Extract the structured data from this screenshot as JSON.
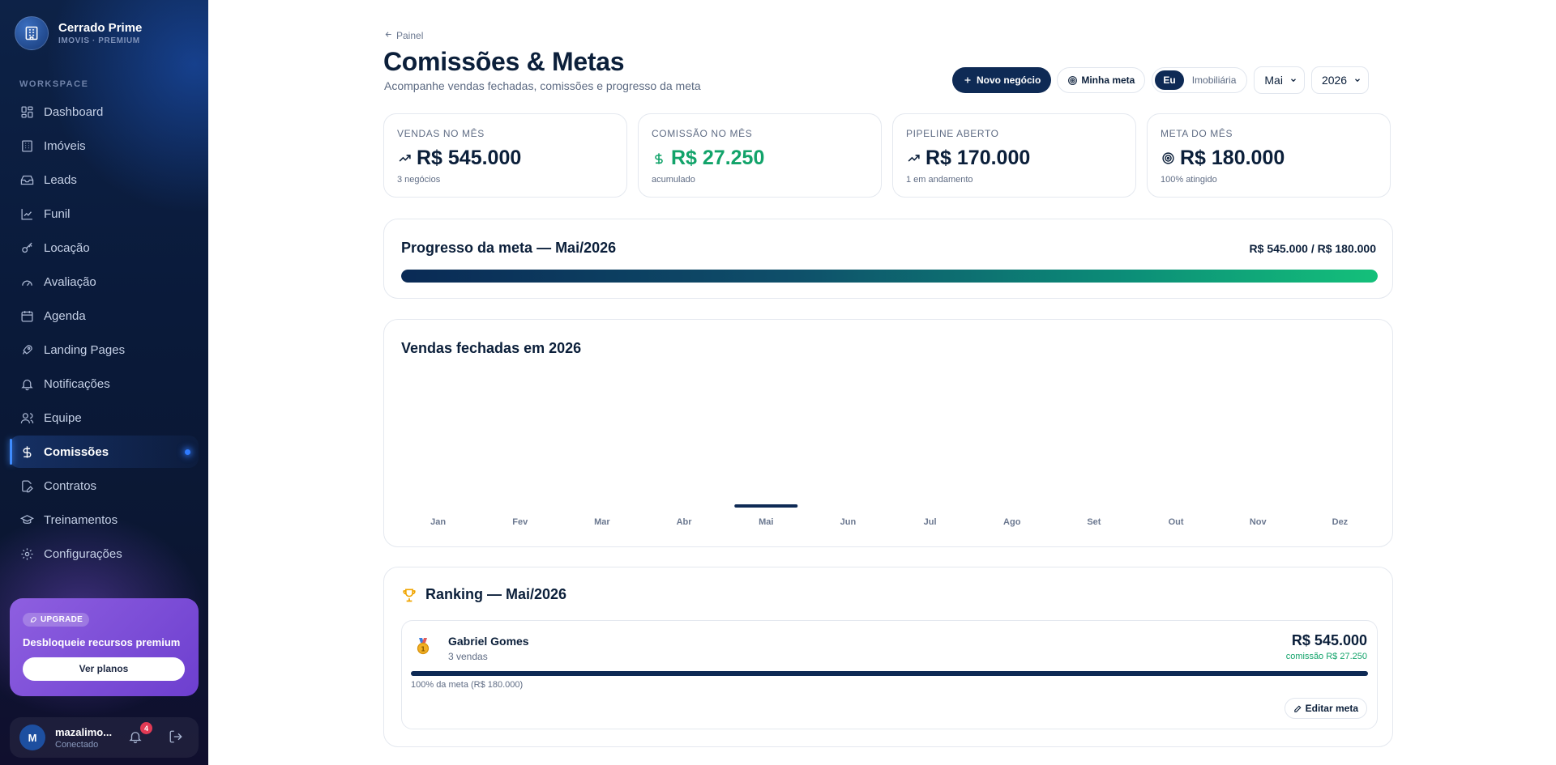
{
  "brand": {
    "name": "Cerrado Prime",
    "subtitle": "IMOVIS · PREMIUM"
  },
  "sidebar": {
    "section_label": "WORKSPACE",
    "items": [
      {
        "label": "Dashboard",
        "icon": "grid-icon",
        "active": false
      },
      {
        "label": "Imóveis",
        "icon": "building-icon",
        "active": false
      },
      {
        "label": "Leads",
        "icon": "inbox-icon",
        "active": false
      },
      {
        "label": "Funil",
        "icon": "chart-line-icon",
        "active": false
      },
      {
        "label": "Locação",
        "icon": "key-icon",
        "active": false
      },
      {
        "label": "Avaliação",
        "icon": "gauge-icon",
        "active": false
      },
      {
        "label": "Agenda",
        "icon": "calendar-icon",
        "active": false
      },
      {
        "label": "Landing Pages",
        "icon": "rocket-icon",
        "active": false
      },
      {
        "label": "Notificações",
        "icon": "bell-icon",
        "active": false
      },
      {
        "label": "Equipe",
        "icon": "users-icon",
        "active": false
      },
      {
        "label": "Comissões",
        "icon": "dollar-icon",
        "active": true
      },
      {
        "label": "Contratos",
        "icon": "file-edit-icon",
        "active": false
      },
      {
        "label": "Treinamentos",
        "icon": "graduation-cap-icon",
        "active": false
      },
      {
        "label": "Configurações",
        "icon": "gear-icon",
        "active": false
      }
    ],
    "upgrade": {
      "badge": "UPGRADE",
      "title": "Desbloqueie recursos premium",
      "button": "Ver planos"
    },
    "user": {
      "initial": "M",
      "name": "mazalimo...",
      "status": "Conectado",
      "notifications": "4"
    }
  },
  "header": {
    "breadcrumb": "Painel",
    "title": "Comissões & Metas",
    "subtitle": "Acompanhe vendas fechadas, comissões e progresso da meta",
    "new_deal": "Novo negócio",
    "my_goal": "Minha meta",
    "scope_options": [
      "Eu",
      "Imobiliária"
    ],
    "scope_selected": "Eu",
    "month": "Mai",
    "year": "2026"
  },
  "stats": [
    {
      "label": "VENDAS NO MÊS",
      "value": "R$ 545.000",
      "foot": "3 negócios",
      "icon": "trending-up-icon",
      "accent": "#0b1f3a"
    },
    {
      "label": "COMISSÃO NO MÊS",
      "value": "R$ 27.250",
      "foot": "acumulado",
      "icon": "dollar-icon",
      "accent": "#12a36a"
    },
    {
      "label": "PIPELINE ABERTO",
      "value": "R$ 170.000",
      "foot": "1 em andamento",
      "icon": "trending-up-icon",
      "accent": "#0b1f3a"
    },
    {
      "label": "META DO MÊS",
      "value": "R$ 180.000",
      "foot": "100% atingido",
      "icon": "target-icon",
      "accent": "#0b1f3a"
    }
  ],
  "progress": {
    "title": "Progresso da meta — Mai/2026",
    "amount": "R$ 545.000 / R$ 180.000",
    "percent": 100
  },
  "chart_data": {
    "type": "bar",
    "title": "Vendas fechadas em 2026",
    "categories": [
      "Jan",
      "Fev",
      "Mar",
      "Abr",
      "Mai",
      "Jun",
      "Jul",
      "Ago",
      "Set",
      "Out",
      "Nov",
      "Dez"
    ],
    "values": [
      0,
      0,
      0,
      0,
      545000,
      0,
      0,
      0,
      0,
      0,
      0,
      0
    ],
    "xlabel": "",
    "ylabel": "",
    "grid": false,
    "bar_color": "#0e2a55"
  },
  "ranking": {
    "title": "Ranking — Mai/2026",
    "entries": [
      {
        "name": "Gabriel Gomes",
        "sales": "3 vendas",
        "value": "R$ 545.000",
        "commission": "comissão R$ 27.250",
        "goal_text": "100% da meta (R$ 180.000)",
        "goal_percent": 100,
        "edit_label": "Editar meta"
      }
    ]
  },
  "colors": {
    "navy": "#0e2a55",
    "green": "#12a36a",
    "purple": "#7c4dd6",
    "danger": "#e23a55"
  }
}
